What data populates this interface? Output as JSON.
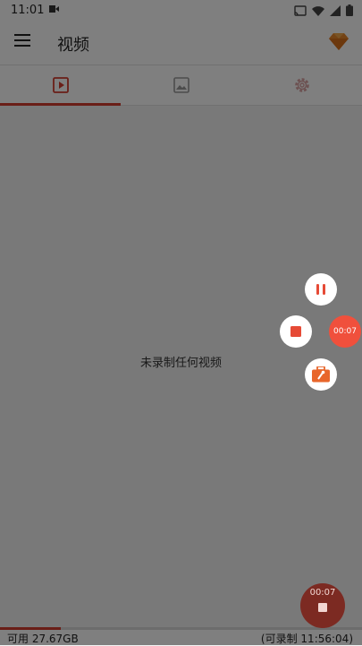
{
  "status_bar": {
    "time": "11:01"
  },
  "app_bar": {
    "title": "视频"
  },
  "tabs": [
    {
      "name": "video",
      "icon": "video-icon",
      "active": true
    },
    {
      "name": "image",
      "icon": "image-icon",
      "active": false
    },
    {
      "name": "settings",
      "icon": "gear-icon",
      "active": false
    }
  ],
  "content": {
    "empty_message": "未录制任何视频"
  },
  "floating_controls": {
    "timer": "00:07"
  },
  "fab": {
    "timer": "00:07"
  },
  "footer": {
    "available": "可用 27.67GB",
    "recordable": "(可录制 11:56:04)"
  },
  "colors": {
    "accent": "#d43d2f",
    "bubble": "#f0503c"
  }
}
